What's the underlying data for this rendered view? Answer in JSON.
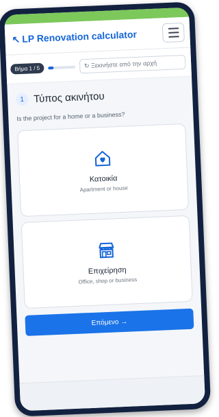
{
  "app": {
    "title": "LP Renovation calculator",
    "brand_color": "#1565d8",
    "accent_bar_color": "#7cc85a"
  },
  "progress": {
    "step_label": "Βήμα 1 / 5",
    "fraction": 0.2,
    "restart_label": "↻ Ξεκινήστε από την αρχή"
  },
  "question": {
    "number": "1",
    "title": "Τύπος ακινήτου",
    "subtitle": "Is the project for a home or a business?"
  },
  "options": [
    {
      "icon": "home-heart-icon",
      "title": "Κατοικία",
      "description": "Apartment or house"
    },
    {
      "icon": "storefront-icon",
      "title": "Επιχείρηση",
      "description": "Office, shop or business"
    }
  ],
  "actions": {
    "next_label": "Επόμενο →"
  }
}
